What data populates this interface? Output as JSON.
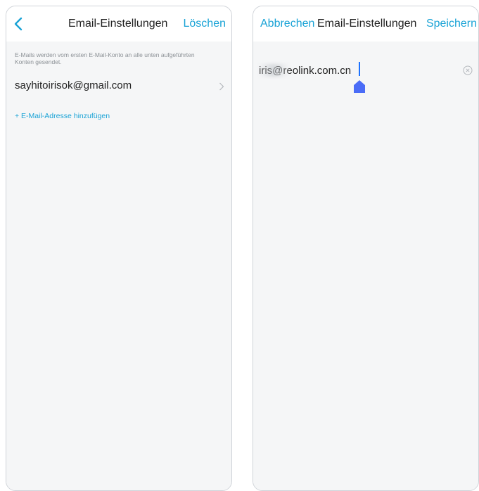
{
  "left_screen": {
    "title": "Email-Einstellungen",
    "delete_label": "Löschen",
    "info_text": "E-Mails werden vom ersten E-Mail-Konto an alle unten aufgeführten Konten gesendet.",
    "emails": [
      "sayhitoirisok@gmail.com"
    ],
    "add_label": "+ E-Mail-Adresse hinzufügen",
    "icons": {
      "back": "chevron-left-icon",
      "row": "chevron-right-icon"
    }
  },
  "right_screen": {
    "title": "Email-Einstellungen",
    "cancel_label": "Abbrechen",
    "save_label": "Speichern",
    "input_value": "iris@reolink.com.cn",
    "icons": {
      "clear": "clear-circle-icon",
      "cursor": "text-cursor-handle-icon"
    }
  },
  "colors": {
    "accent": "#1aa3d6",
    "text": "#222222",
    "secondary_text": "#8c9196",
    "background": "#f5f6f7",
    "caret": "#1e73ff",
    "cursor_handle": "#4a6cf7"
  }
}
